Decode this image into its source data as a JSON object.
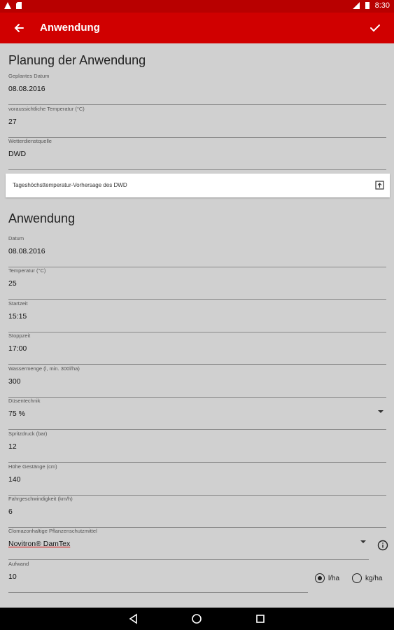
{
  "status": {
    "time": "8:30"
  },
  "appbar": {
    "title": "Anwendung"
  },
  "planung": {
    "title": "Planung der Anwendung",
    "fields": [
      {
        "label": "Geplantes Datum",
        "value": "08.08.2016"
      },
      {
        "label": "voraussichtliche Temperatur (°C)",
        "value": "27"
      },
      {
        "label": "Wetterdienstquelle",
        "value": "DWD"
      }
    ],
    "card_text": "Tageshöchsttemperatur-Vorhersage des DWD"
  },
  "anwendung": {
    "title": "Anwendung",
    "fields": [
      {
        "label": "Datum",
        "value": "08.08.2016"
      },
      {
        "label": "Temperatur (°C)",
        "value": "25"
      },
      {
        "label": "Startzeit",
        "value": "15:15"
      },
      {
        "label": "Stoppzeit",
        "value": "17:00"
      },
      {
        "label": "Wassermenge (l, min. 300l/ha)",
        "value": "300"
      },
      {
        "label": "Düsentechnik",
        "value": "75 %"
      },
      {
        "label": "Spritzdruck (bar)",
        "value": "12"
      },
      {
        "label": "Höhe Gestänge (cm)",
        "value": "140"
      },
      {
        "label": "Fahrgeschwindigkeit (km/h)",
        "value": "6"
      },
      {
        "label": "Clomazonhaltige Pflanzenschutzmittel",
        "value": "Novitron® DamTex"
      },
      {
        "label": "Aufwand",
        "value": "10"
      }
    ],
    "units": {
      "lha": "l/ha",
      "kgha": "kg/ha",
      "selected": "l/ha"
    }
  },
  "colors": {
    "appbar": "#d00000",
    "statusbar": "#b80000",
    "background": "#d0d0d0"
  }
}
